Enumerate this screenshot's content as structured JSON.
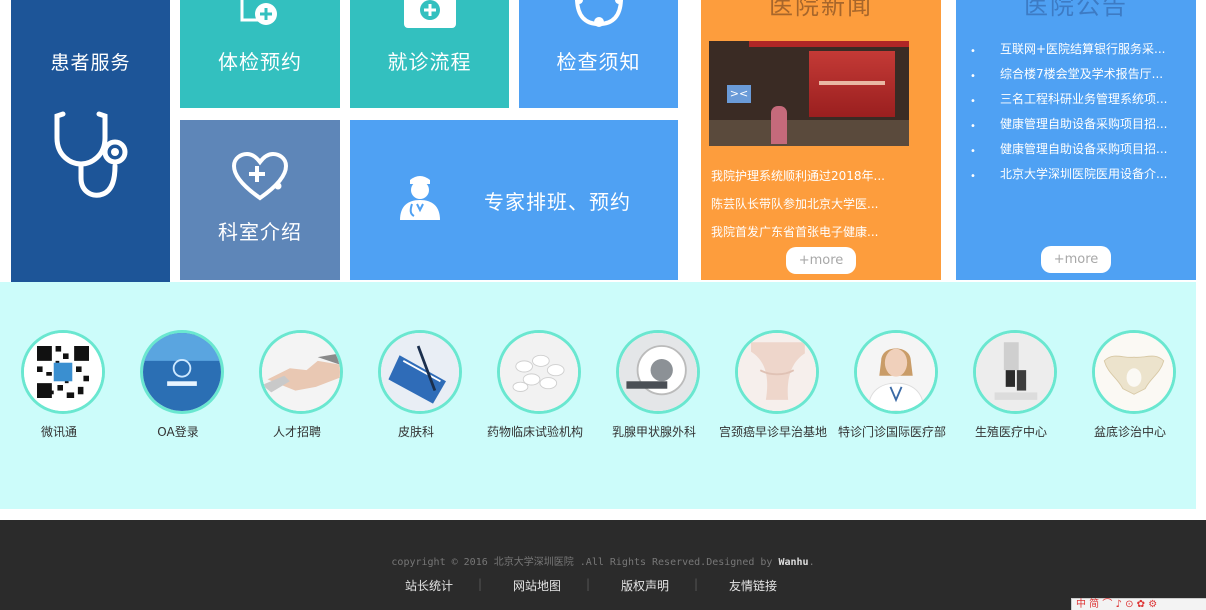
{
  "tiles": {
    "patient": "患者服务",
    "exam": "体检预约",
    "flow": "就诊流程",
    "notice": "检查须知",
    "dept": "科室介绍",
    "expert": "专家排班、预约"
  },
  "news": {
    "title": "医院新闻",
    "arrow": "><",
    "items": [
      "我院护理系统顺利通过2018年...",
      "陈芸队长带队参加北京大学医...",
      "我院首发广东省首张电子健康..."
    ],
    "more": "+more"
  },
  "announce": {
    "title": "医院公告",
    "bullet": "•",
    "items": [
      "互联网+医院结算银行服务采...",
      "综合楼7楼会堂及学术报告厅...",
      "三名工程科研业务管理系统项...",
      "健康管理自助设备采购项目招...",
      "健康管理自助设备采购项目招...",
      "北京大学深圳医院医用设备介..."
    ],
    "more": "+more"
  },
  "quick_links": [
    {
      "label": "微讯通",
      "icon": "qr-code-icon"
    },
    {
      "label": "OA登录",
      "icon": "oa-login-screen-icon"
    },
    {
      "label": "人才招聘",
      "icon": "handshake-icon"
    },
    {
      "label": "皮肤科",
      "icon": "clipboard-pen-icon"
    },
    {
      "label": "药物临床试验机构",
      "icon": "pills-icon"
    },
    {
      "label": "乳腺甲状腺外科",
      "icon": "ct-scanner-icon"
    },
    {
      "label": "宫颈癌早诊早治基地",
      "icon": "abdomen-icon"
    },
    {
      "label": "特诊门诊国际医疗部",
      "icon": "doctor-icon"
    },
    {
      "label": "生殖医疗中心",
      "icon": "microscope-icon"
    },
    {
      "label": "盆底诊治中心",
      "icon": "pelvis-icon"
    }
  ],
  "footer": {
    "copyright_prefix": "copyright © 2016 北京大学深圳医院 .All Rights Reserved.Designed by ",
    "designer": "Wanhu",
    "copyright_suffix": ".",
    "links": [
      "站长统计",
      "网站地图",
      "版权声明",
      "友情链接"
    ],
    "separator": "|"
  },
  "ime_bar": "中 简 ⌒ ♪ ⊙ ✿ ⚙",
  "colors": {
    "navy": "#1d5598",
    "teal": "#33c0bf",
    "blue": "#4fa1f3",
    "slate": "#5e86b8",
    "orange": "#fd9d3d",
    "mint_band": "#ccfcfa",
    "footer": "#2b2b2b"
  }
}
